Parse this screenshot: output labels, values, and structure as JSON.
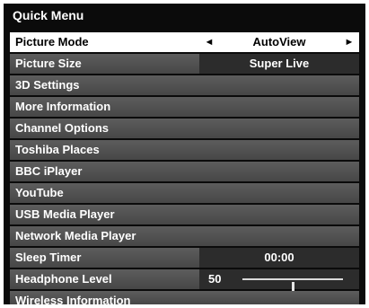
{
  "menu": {
    "title": "Quick Menu",
    "items": [
      {
        "label": "Picture Mode",
        "value": "AutoView"
      },
      {
        "label": "Picture Size",
        "value": "Super Live"
      },
      {
        "label": "3D Settings"
      },
      {
        "label": "More Information"
      },
      {
        "label": "Channel Options"
      },
      {
        "label": "Toshiba Places"
      },
      {
        "label": "BBC iPlayer"
      },
      {
        "label": "YouTube"
      },
      {
        "label": "USB Media Player"
      },
      {
        "label": "Network Media Player"
      },
      {
        "label": "Sleep Timer",
        "value": "00:00"
      },
      {
        "label": "Headphone Level",
        "value": "50",
        "level_fraction": 0.5
      },
      {
        "label": "Wireless Information"
      }
    ],
    "selected_index": 0,
    "arrow_left": "◄",
    "arrow_right": "►"
  }
}
